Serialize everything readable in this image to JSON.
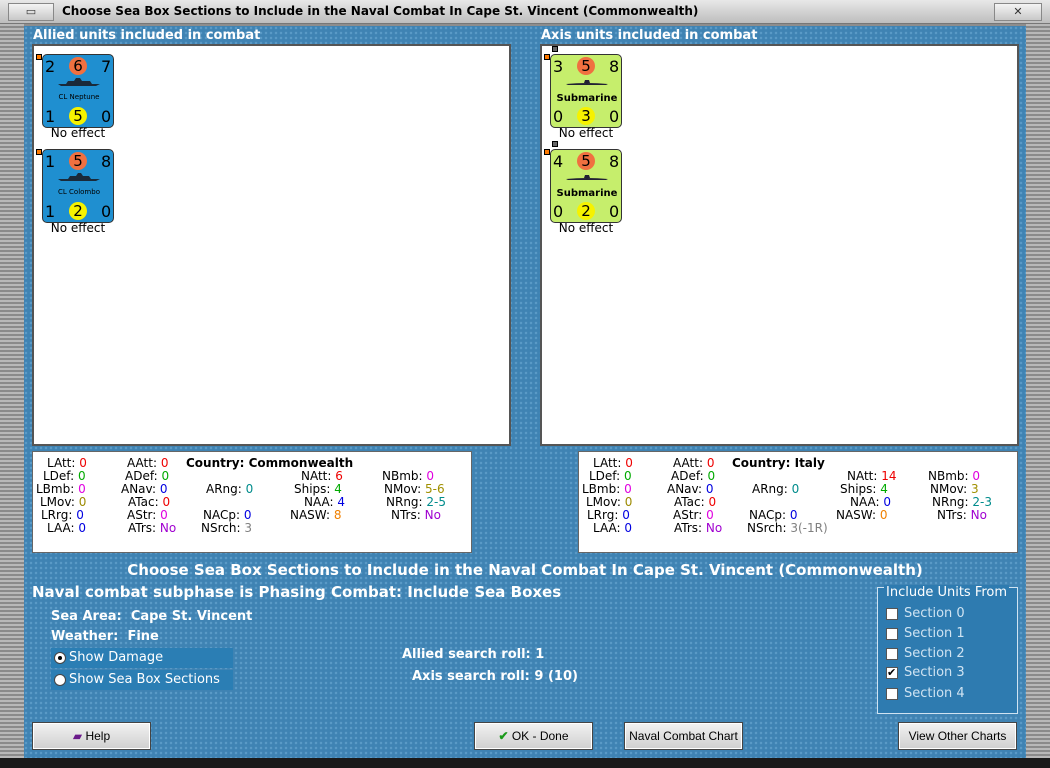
{
  "window": {
    "title": "Choose Sea Box Sections to Include in the Naval Combat In Cape St. Vincent (Commonwealth)",
    "restore_btn": "▭",
    "close_btn": "✕"
  },
  "allied": {
    "label": "Allied units included in combat",
    "units": [
      {
        "tl": "2",
        "tc": "6",
        "tr": "7",
        "name": "CL Neptune",
        "bl": "1",
        "bc": "5",
        "br": "0",
        "caption": "No effect"
      },
      {
        "tl": "1",
        "tc": "5",
        "tr": "8",
        "name": "CL Colombo",
        "bl": "1",
        "bc": "2",
        "br": "0",
        "caption": "No effect"
      }
    ]
  },
  "axis": {
    "label": "Axis units included in combat",
    "units": [
      {
        "tl": "3",
        "tc": "5",
        "tr": "8",
        "name": "Submarine",
        "bl": "0",
        "bc": "3",
        "br": "0",
        "caption": "No effect"
      },
      {
        "tl": "4",
        "tc": "5",
        "tr": "8",
        "name": "Submarine",
        "bl": "0",
        "bc": "2",
        "br": "0",
        "caption": "No effect"
      }
    ]
  },
  "allied_stats": {
    "latt_l": "LAtt:",
    "latt": "0",
    "ldef_l": "LDef:",
    "ldef": "0",
    "lbmb_l": "LBmb:",
    "lbmb": "0",
    "lmov_l": "LMov:",
    "lmov": "0",
    "lrrg_l": "LRrg:",
    "lrrg": "0",
    "laa_l": "LAA:",
    "laa": "0",
    "aatt_l": "AAtt:",
    "aatt": "0",
    "adef_l": "ADef:",
    "adef": "0",
    "anav_l": "ANav:",
    "anav": "0",
    "atac_l": "ATac:",
    "atac": "0",
    "astr_l": "AStr:",
    "astr": "0",
    "atrs_l": "ATrs:",
    "atrs": "No",
    "country_l": "Country:",
    "country": "Commonwealth",
    "arng_l": "ARng:",
    "arng": "0",
    "nacp_l": "NACp:",
    "nacp": "0",
    "nsrch_l": "NSrch:",
    "nsrch": "3",
    "natt_l": "NAtt:",
    "natt": "6",
    "ships_l": "Ships:",
    "ships": "4",
    "naa_l": "NAA:",
    "naa": "4",
    "nasw_l": "NASW:",
    "nasw": "8",
    "nbmb_l": "NBmb:",
    "nbmb": "0",
    "nmov_l": "NMov:",
    "nmov": "5-6",
    "nrng_l": "NRng:",
    "nrng": "2-5",
    "ntrs_l": "NTrs:",
    "ntrs": "No"
  },
  "axis_stats": {
    "latt_l": "LAtt:",
    "latt": "0",
    "ldef_l": "LDef:",
    "ldef": "0",
    "lbmb_l": "LBmb:",
    "lbmb": "0",
    "lmov_l": "LMov:",
    "lmov": "0",
    "lrrg_l": "LRrg:",
    "lrrg": "0",
    "laa_l": "LAA:",
    "laa": "0",
    "aatt_l": "AAtt:",
    "aatt": "0",
    "adef_l": "ADef:",
    "adef": "0",
    "anav_l": "ANav:",
    "anav": "0",
    "atac_l": "ATac:",
    "atac": "0",
    "astr_l": "AStr:",
    "astr": "0",
    "atrs_l": "ATrs:",
    "atrs": "No",
    "country_l": "Country:",
    "country": "Italy",
    "arng_l": "ARng:",
    "arng": "0",
    "nacp_l": "NACp:",
    "nacp": "0",
    "nsrch_l": "NSrch:",
    "nsrch": "3(-1R)",
    "natt_l": "NAtt:",
    "natt": "14",
    "ships_l": "Ships:",
    "ships": "4",
    "naa_l": "NAA:",
    "naa": "0",
    "nasw_l": "NASW:",
    "nasw": "0",
    "nbmb_l": "NBmb:",
    "nbmb": "0",
    "nmov_l": "NMov:",
    "nmov": "3",
    "nrng_l": "NRng:",
    "nrng": "2-3",
    "ntrs_l": "NTrs:",
    "ntrs": "No"
  },
  "main": {
    "heading": "Choose Sea Box Sections to Include in the Naval Combat In Cape St. Vincent (Commonwealth)",
    "subphase": "Naval combat subphase is Phasing Combat: Include Sea Boxes",
    "sea_area_l": "Sea Area:",
    "sea_area": "Cape St. Vincent",
    "weather_l": "Weather:",
    "weather": "Fine",
    "show_damage": "Show Damage",
    "show_sections": "Show Sea Box Sections",
    "allied_roll_l": "Allied search roll:",
    "allied_roll": "1",
    "axis_roll_l": "Axis search roll:",
    "axis_roll": "9 (10)"
  },
  "include": {
    "legend": "Include Units From",
    "sections": [
      {
        "label": "Section 0",
        "checked": false
      },
      {
        "label": "Section 1",
        "checked": false
      },
      {
        "label": "Section 2",
        "checked": false
      },
      {
        "label": "Section 3",
        "checked": true
      },
      {
        "label": "Section 4",
        "checked": false
      }
    ]
  },
  "buttons": {
    "help": "Help",
    "ok": "OK - Done",
    "chart": "Naval Combat Chart",
    "other": "View Other Charts"
  },
  "colors": {
    "sea": "#3f83b3",
    "allied_unit": "#1f8fd0",
    "axis_unit": "#c6ee6c"
  }
}
